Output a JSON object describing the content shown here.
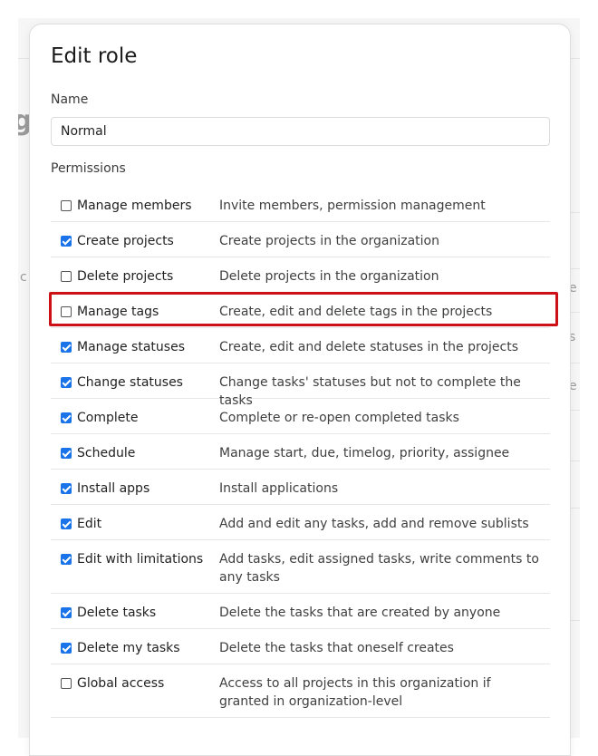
{
  "modal": {
    "title": "Edit role",
    "name_label": "Name",
    "name_value": "Normal",
    "permissions_label": "Permissions"
  },
  "permissions": [
    {
      "name": "Manage members",
      "description": "Invite members, permission management",
      "checked": false
    },
    {
      "name": "Create projects",
      "description": "Create projects in the organization",
      "checked": true
    },
    {
      "name": "Delete projects",
      "description": "Delete projects in the organization",
      "checked": false
    },
    {
      "name": "Manage tags",
      "description": "Create, edit and delete tags in the projects",
      "checked": false,
      "highlighted": true
    },
    {
      "name": "Manage statuses",
      "description": "Create, edit and delete statuses in the projects",
      "checked": true
    },
    {
      "name": "Change statuses",
      "description": "Change tasks' statuses but not to complete the tasks",
      "checked": true
    },
    {
      "name": "Complete",
      "description": "Complete or re-open completed tasks",
      "checked": true
    },
    {
      "name": "Schedule",
      "description": "Manage start, due, timelog, priority, assignee",
      "checked": true
    },
    {
      "name": "Install apps",
      "description": "Install applications",
      "checked": true
    },
    {
      "name": "Edit",
      "description": "Add and edit any tasks, add and remove sublists",
      "checked": true
    },
    {
      "name": "Edit with limitations",
      "description": "Add tasks, edit assigned tasks, write comments to any tasks",
      "checked": true
    },
    {
      "name": "Delete tasks",
      "description": "Delete the tasks that are created by anyone",
      "checked": true
    },
    {
      "name": "Delete my tasks",
      "description": "Delete the tasks that oneself creates",
      "checked": true
    },
    {
      "name": "Global access",
      "description": "Access to all projects in this organization if granted in organization-level",
      "checked": false
    }
  ],
  "colors": {
    "checkbox_checked": "#1a73e8",
    "highlight_border": "#cc1016"
  }
}
